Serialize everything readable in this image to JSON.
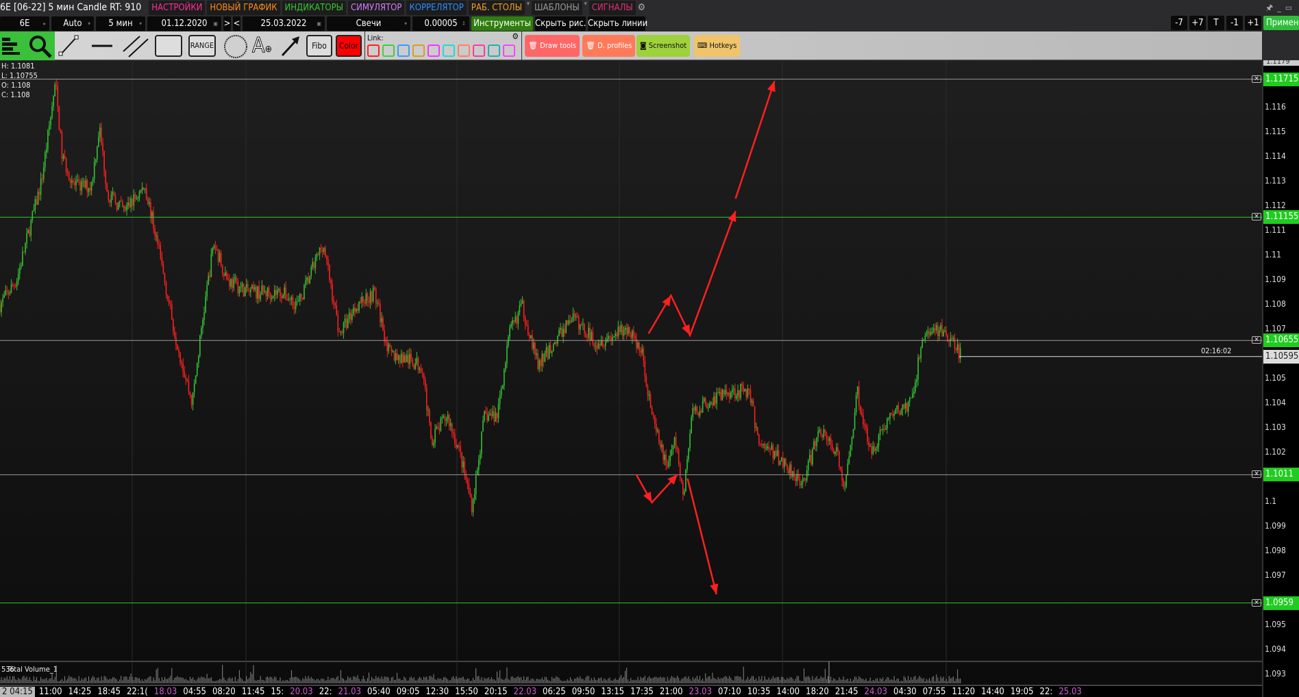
{
  "header": {
    "title": "6E [06-22] 5 мин Candle RT: 910",
    "menu": [
      {
        "label": "НАСТРОЙКИ",
        "color": "#ff2f9a"
      },
      {
        "label": "НОВЫЙ ГРАФИК",
        "color": "#ff8a1c"
      },
      {
        "label": "ИНДИКАТОРЫ",
        "color": "#39c634"
      },
      {
        "label": "СИМУЛЯТОР",
        "color": "#d37cff"
      },
      {
        "label": "КОРРЕЛЯТОР",
        "color": "#2f8cff"
      },
      {
        "label": "РАБ. СТОЛЫ",
        "color": "#f0a020"
      },
      {
        "label": "ШАБЛОНЫ",
        "color": "#9a9a9a"
      },
      {
        "label": "СИГНАЛЫ",
        "color": "#e0307a"
      }
    ]
  },
  "controls": {
    "symbol": "6E",
    "scale": "Auto",
    "timeframe": "5 мин",
    "date_from": "01.12.2020",
    "next": ">",
    "prev": "<",
    "date_to": "25.03.2022",
    "chart_type": "Свечи",
    "tick_size": "0.00005",
    "instruments": "Инструменты",
    "hide_drawings": "Скрыть рис.",
    "hide_lines": "Скрыть линии",
    "right_buttons": [
      "-7",
      "+7",
      "T",
      "-1",
      "+1"
    ],
    "apply": "Применить"
  },
  "toolbar": {
    "range": "RANGE",
    "fibo": "Fibo",
    "color": "Color",
    "link_label": "Link:",
    "link_colors": [
      "#ff2020",
      "#40d040",
      "#3a9cff",
      "#d4a020",
      "#ff30ff",
      "#20d8d8",
      "#ff8060",
      "#ff3aa0",
      "#20b0b0",
      "#ff40ff"
    ],
    "draw_tools": "Draw tools",
    "d_profiles": "D. profiles",
    "screenshot": "Screenshot",
    "hotkeys": "Hotkeys"
  },
  "ohlc": {
    "h": "H: 1.1081",
    "l": "L: 1.10755",
    "o": "O: 1.108",
    "c": "C: 1.108"
  },
  "chart_data": {
    "type": "candlestick",
    "symbol": "6E",
    "timeframe": "5 мин",
    "price_ticks": [
      "1.116",
      "1.115",
      "1.114",
      "1.113",
      "1.112",
      "1.111",
      "1.11",
      "1.109",
      "1.108",
      "1.107",
      "1.105",
      "1.104",
      "1.103",
      "1.102",
      "1.1",
      "1.099",
      "1.098",
      "1.097",
      "1.095",
      "1.094",
      "1.093"
    ],
    "top_tick": "1.1179",
    "levels": [
      {
        "price": "1.11715",
        "line": "#9a9a9a"
      },
      {
        "price": "1.11155",
        "line": "#2fc82f"
      },
      {
        "price": "1.10655",
        "line": "#9a9a9a"
      },
      {
        "price": "1.1011",
        "line": "#9a9a9a"
      },
      {
        "price": "1.0959",
        "line": "#2fc82f"
      }
    ],
    "current_price": "1.10595",
    "countdown": "02:16:02",
    "volume_label": "Total Volume_1",
    "volume_value": "536",
    "time_labels": [
      "2 04:15",
      "11:00",
      "14:25",
      "18:45",
      "22:1(",
      "18.03",
      "04:55",
      "08:20",
      "11:45",
      "15:",
      "20.03",
      "22:",
      "21.03",
      "05:40",
      "09:05",
      "12:30",
      "15:50",
      "20:15",
      "22.03",
      "06:25",
      "09:50",
      "13:15",
      "17:35",
      "21:00",
      "23.03",
      "07:10",
      "10:35",
      "14:00",
      "18:20",
      "21:45",
      "24.03",
      "04:30",
      "07:55",
      "11:20",
      "14:40",
      "19:05",
      "22:",
      "25.03"
    ],
    "up_color": "#34c234",
    "down_color": "#ff2020",
    "annotation_color": "#ff2020"
  }
}
